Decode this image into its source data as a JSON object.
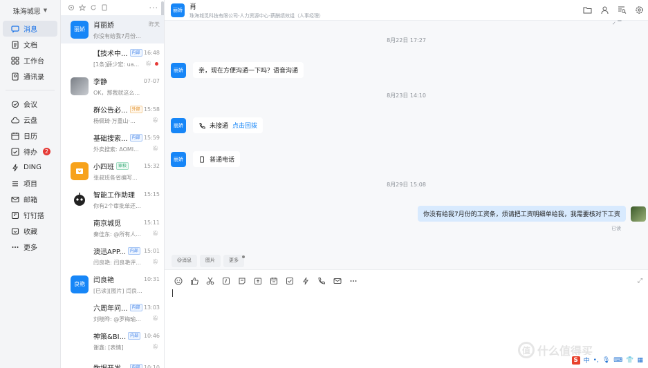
{
  "org": {
    "name": "珠海城思"
  },
  "nav": {
    "items": [
      {
        "label": "消息",
        "icon": "message-icon",
        "active": true
      },
      {
        "label": "文档",
        "icon": "document-icon"
      },
      {
        "label": "工作台",
        "icon": "workbench-icon"
      },
      {
        "label": "通讯录",
        "icon": "contacts-icon"
      },
      {
        "label": "会议",
        "icon": "meeting-icon"
      },
      {
        "label": "云盘",
        "icon": "cloud-icon"
      },
      {
        "label": "日历",
        "icon": "calendar-icon"
      },
      {
        "label": "待办",
        "icon": "todo-icon",
        "badge": "2"
      },
      {
        "label": "DING",
        "icon": "ding-icon"
      },
      {
        "label": "项目",
        "icon": "project-icon"
      },
      {
        "label": "邮箱",
        "icon": "mail-icon"
      },
      {
        "label": "钉钉搭",
        "icon": "build-icon"
      },
      {
        "label": "收藏",
        "icon": "favorite-icon"
      },
      {
        "label": "更多",
        "icon": "more-icon"
      }
    ]
  },
  "conversations": [
    {
      "name": "肖丽娇",
      "time": "昨天",
      "preview": "你没有给我7月份...",
      "avatar": "丽娇",
      "avatar_type": "blue",
      "active": true
    },
    {
      "name": "【技术中...",
      "tag": "内部",
      "tag_type": "inner",
      "time": "16:48",
      "preview": "[1条]薛少宏: ua...",
      "avatar_type": "grid",
      "muted": true,
      "unread_dot": true
    },
    {
      "name": "李静",
      "time": "07-07",
      "preview": "OK，那我就这么...",
      "avatar_type": "photo"
    },
    {
      "name": "群公告必...",
      "tag": "外部",
      "tag_type": "ext",
      "time": "15:58",
      "preview": "杨佩琦·万重山·...",
      "avatar_type": "grid",
      "muted": true
    },
    {
      "name": "基础搜索...",
      "tag": "内部",
      "tag_type": "inner",
      "time": "15:59",
      "preview": "外卖搜索: AOMI...",
      "avatar_type": "grid",
      "muted": true
    },
    {
      "name": "小四班",
      "tag": "家校",
      "tag_type": "green",
      "time": "15:32",
      "preview": "张叔班各省编写...",
      "avatar": "",
      "avatar_type": "orange"
    },
    {
      "name": "智能工作助理",
      "time": "15:15",
      "preview": "你有2个审批单还...",
      "avatar_type": "bot"
    },
    {
      "name": "南京城觅",
      "time": "15:11",
      "preview": "秦佳东: @所有人...",
      "avatar_type": "grid",
      "muted": true
    },
    {
      "name": "澳迅APP...",
      "tag": "内部",
      "tag_type": "inner",
      "time": "15:01",
      "preview": "闫良艳: 闫良艳评...",
      "avatar_type": "grid",
      "muted": true
    },
    {
      "name": "闫良艳",
      "time": "10:31",
      "preview": "[已读][图片] 闫良...",
      "avatar": "良艳",
      "avatar_type": "blue"
    },
    {
      "name": "六周年问...",
      "tag": "内部",
      "tag_type": "inner",
      "time": "13:03",
      "preview": "刘晓晔: @罗梅瑜...",
      "avatar_type": "grid",
      "muted": true
    },
    {
      "name": "神策&BI...",
      "tag": "内部",
      "tag_type": "inner",
      "time": "10:46",
      "preview": "谢鑫: [表情]",
      "avatar_type": "grid",
      "muted": true
    },
    {
      "name": "数据开发...",
      "tag": "内部",
      "tag_type": "inner",
      "time": "10:10",
      "preview": "",
      "avatar_type": "grid"
    }
  ],
  "chat": {
    "name": "肖",
    "subtitle": "珠海城觅科技有限公司-人力资源中心-薪酬绩效组（人事经理）",
    "avatar": "丽娇",
    "messages": [
      {
        "type": "timestamp",
        "text": "8月22日 17:27"
      },
      {
        "type": "text",
        "from": "them",
        "text": "亲，现在方便沟通一下吗？语音沟通"
      },
      {
        "type": "timestamp",
        "text": "8月23日 14:10"
      },
      {
        "type": "call",
        "from": "them",
        "text": "未接通",
        "action": "点击回拨"
      },
      {
        "type": "call",
        "from": "them",
        "text": "普通电话"
      },
      {
        "type": "timestamp",
        "text": "8月29日 15:08"
      },
      {
        "type": "text",
        "from": "me",
        "text": "你没有给我7月份的工资条，烦请把工资明细单给我，我需要核对下工资",
        "read": "已读"
      }
    ]
  },
  "composer": {
    "tabs": [
      "@消息",
      "图片",
      "更多"
    ],
    "tools": [
      "emoji-icon",
      "like-icon",
      "scissors-icon",
      "quote-icon",
      "task-icon",
      "upload-icon",
      "schedule-icon",
      "check-icon",
      "ding-icon",
      "phone-icon",
      "mail-icon",
      "more-icon"
    ]
  },
  "ime": {
    "lang": "中",
    "punct": "•,"
  },
  "watermark": {
    "text": "什么值得买",
    "mark": "值"
  }
}
